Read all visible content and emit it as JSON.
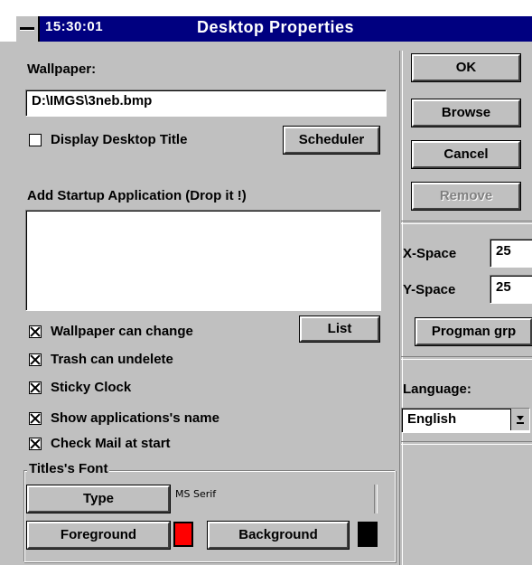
{
  "window": {
    "title": "Desktop Properties",
    "clock": "15:30:01"
  },
  "wallpaper": {
    "label": "Wallpaper:",
    "value": "D:\\IMGS\\3neb.bmp"
  },
  "display_title": {
    "label": "Display Desktop Title",
    "checked": false
  },
  "buttons": {
    "scheduler": "Scheduler",
    "ok": "OK",
    "browse": "Browse",
    "cancel": "Cancel",
    "remove": "Remove",
    "list": "List",
    "progman": "Progman grp",
    "type": "Type",
    "foreground": "Foreground",
    "background": "Background"
  },
  "startup": {
    "label": "Add Startup Application (Drop it !)",
    "items": []
  },
  "options": [
    {
      "label": "Wallpaper can change",
      "checked": true
    },
    {
      "label": "Trash can undelete",
      "checked": true
    },
    {
      "label": "Sticky Clock",
      "checked": true
    },
    {
      "label": "Show applications's name",
      "checked": true
    },
    {
      "label": "Check Mail at start",
      "checked": true
    }
  ],
  "spacing": {
    "x_label": "X-Space",
    "x_value": "25",
    "y_label": "Y-Space",
    "y_value": "25"
  },
  "language": {
    "label": "Language:",
    "selected": "English"
  },
  "font_group": {
    "label": "Titles's Font",
    "font_name": "MS Serif",
    "foreground_color": "#ff0000",
    "background_color": "#000000"
  },
  "colors": {
    "title_bar": "#000080",
    "face": "#c0c0c0"
  }
}
